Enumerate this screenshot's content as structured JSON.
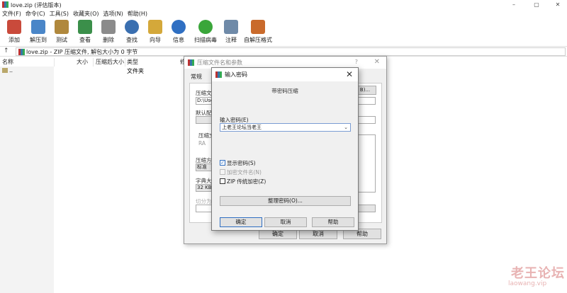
{
  "window": {
    "title": "love.zip (评估版本)",
    "controls": [
      "–",
      "▢",
      "✕"
    ]
  },
  "menu": [
    "文件(F)",
    "命令(C)",
    "工具(S)",
    "收藏夹(O)",
    "选项(N)",
    "帮助(H)"
  ],
  "toolbar": [
    {
      "label": "添加",
      "icon": "add-archive-icon",
      "color": "#c94a3b"
    },
    {
      "label": "解压到",
      "icon": "extract-folder-icon",
      "color": "#4a86c8"
    },
    {
      "label": "测试",
      "icon": "test-clipboard-icon",
      "color": "#b0883d"
    },
    {
      "label": "查看",
      "icon": "view-book-icon",
      "color": "#3b8f4a"
    },
    {
      "label": "删除",
      "icon": "delete-trash-icon",
      "color": "#8b8b8b"
    },
    {
      "label": "查找",
      "icon": "find-magnifier-icon",
      "color": "#3a6fb0"
    },
    {
      "label": "向导",
      "icon": "wizard-wand-icon",
      "color": "#d4a83a"
    },
    {
      "label": "信息",
      "icon": "info-icon",
      "color": "#2f6fc2"
    },
    {
      "label": "扫描病毒",
      "icon": "virus-scan-icon",
      "color": "#3aa63a"
    },
    {
      "label": "注释",
      "icon": "comment-icon",
      "color": "#6f8aa8"
    },
    {
      "label": "自解压格式",
      "icon": "sfx-archive-icon",
      "color": "#c96a2b"
    }
  ],
  "address": {
    "text": "love.zip - ZIP 压缩文件, 解包大小为 0 字节"
  },
  "filelist": {
    "columns": [
      "名称",
      "大小",
      "压缩后大小",
      "类型",
      "修"
    ],
    "rows": [
      {
        "name": "..",
        "type": "文件夹"
      }
    ]
  },
  "archive_dialog": {
    "title": "压缩文件名和参数",
    "help": "?",
    "close": "✕",
    "tabs": [
      "常规"
    ],
    "labels": {
      "archive_name": "压缩文(",
      "default_config": "默认配",
      "archive_format": "压缩文",
      "rar": "RA",
      "compress_method": "压缩方",
      "dict_size": "字典大小",
      "split": "切分为"
    },
    "browse_button": "B)...",
    "path_value": "D:\\Use",
    "method_value": "标准",
    "dict_value": "32 KB",
    "buttons": {
      "ok": "确定",
      "cancel": "取消",
      "help": "帮助"
    }
  },
  "password_dialog": {
    "title": "输入密码",
    "subtitle": "带密码压缩",
    "password_label": "输入密码(E)",
    "password_value": "上老王论坛当老王",
    "checkboxes": [
      {
        "label": "显示密码(S)",
        "checked": true,
        "disabled": false
      },
      {
        "label": "加密文件名(N)",
        "checked": false,
        "disabled": true
      },
      {
        "label": "ZIP 传统加密(Z)",
        "checked": false,
        "disabled": false
      }
    ],
    "organize_button": "整理密码(O)...",
    "buttons": {
      "ok": "确定",
      "cancel": "取消",
      "help": "帮助"
    }
  },
  "watermark": {
    "cn": "老王论坛",
    "en": "laowang.vip"
  }
}
